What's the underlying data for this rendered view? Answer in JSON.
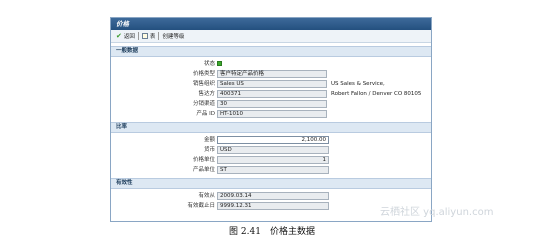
{
  "window": {
    "title": "价格"
  },
  "toolbar": {
    "back_label": "返回",
    "save_label": "表",
    "create_condition_label": "创建等级"
  },
  "sections": {
    "general": "一般数据",
    "rate": "比率",
    "validity": "有效性"
  },
  "general": {
    "status_label": "状态",
    "price_type_label": "价格类型",
    "price_type_value": "客户特定产品价格",
    "sales_org_label": "销售组织",
    "sales_org_value": "Sales US",
    "sales_org_desc": "US Sales & Service,",
    "sold_to_label": "售达方",
    "sold_to_value": "400371",
    "sold_to_desc": "Robert Fallon / Denver CO 80105",
    "dist_channel_label": "分销渠道",
    "dist_channel_value": "30",
    "product_id_label": "产品 ID",
    "product_id_value": "HT-1010"
  },
  "rate": {
    "amount_label": "金额",
    "amount_value": "2,100.00",
    "currency_label": "货币",
    "currency_value": "USD",
    "price_unit_label": "价格单位",
    "price_unit_value": "1",
    "product_unit_label": "产品单位",
    "product_unit_value": "ST"
  },
  "validity": {
    "valid_from_label": "有效从",
    "valid_from_value": "2009.03.14",
    "valid_to_label": "有效截止日",
    "valid_to_value": "9999.12.31"
  },
  "caption": "图 2.41　价格主数据",
  "watermark": "云栖社区 yq.aliyun.com",
  "colors": {
    "titlebar": "#24507f",
    "section_bg": "#dde8f3",
    "status_ok": "#3caa2c"
  }
}
